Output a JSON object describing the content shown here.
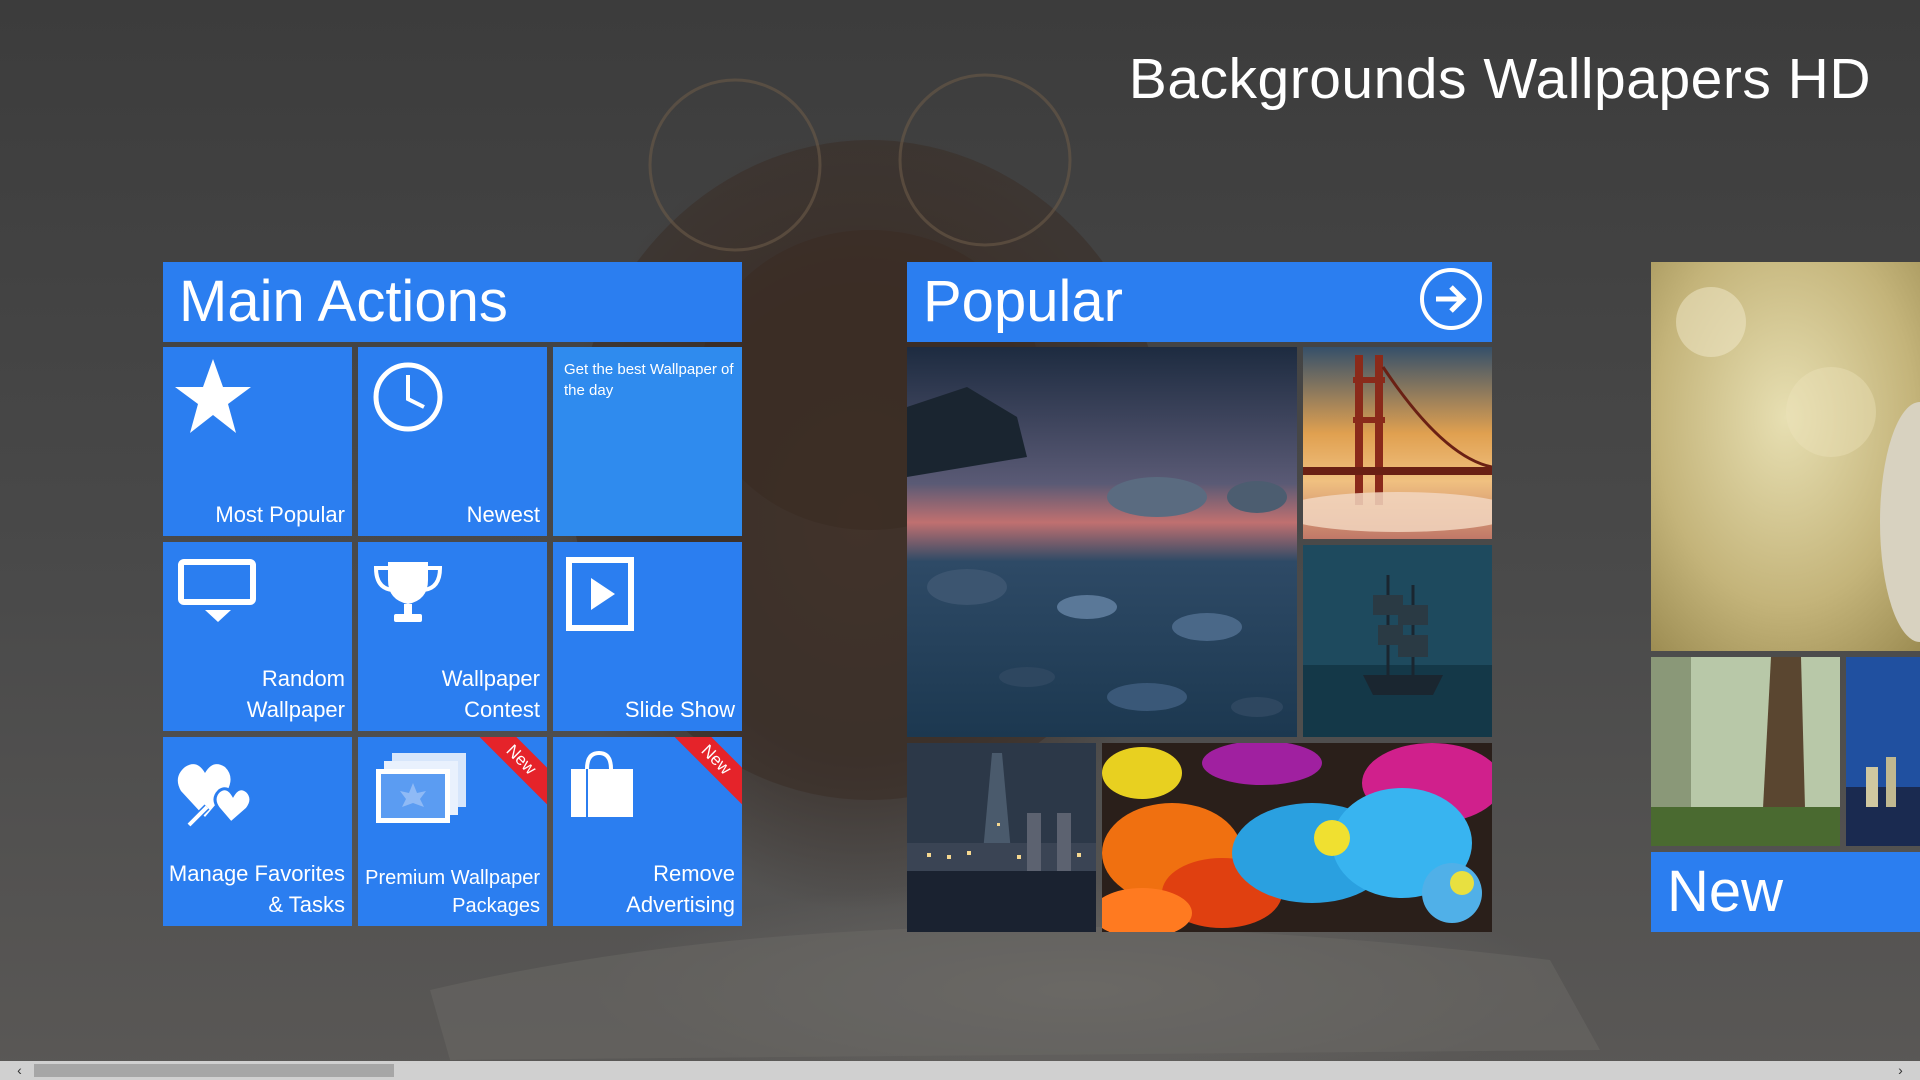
{
  "app": {
    "title": "Backgrounds Wallpapers HD"
  },
  "main_actions": {
    "header": "Main Actions",
    "tiles": [
      {
        "label": "Most Popular",
        "icon": "star-icon"
      },
      {
        "label": "Newest",
        "icon": "clock-icon"
      },
      {
        "tagline": "Get the best Wallpaper of the day"
      },
      {
        "line1": "Random",
        "line2": "Wallpaper",
        "icon": "monitor-icon"
      },
      {
        "line1": "Wallpaper",
        "line2": "Contest",
        "icon": "trophy-icon"
      },
      {
        "label": "Slide Show",
        "icon": "play-icon"
      },
      {
        "line1": "Manage Favorites",
        "line2": "& Tasks",
        "icon": "heart-wrench-icon"
      },
      {
        "line1": "Premium Wallpaper",
        "line2": "Packages",
        "icon": "wallpaper-stack-icon",
        "badge": "New"
      },
      {
        "line1": "Remove",
        "line2": "Advertising",
        "icon": "shopping-bag-icon",
        "badge": "New"
      }
    ]
  },
  "popular": {
    "header": "Popular",
    "arrow_icon": "arrow-right-circle-icon",
    "photos": [
      "lake-rocks",
      "golden-gate-bridge",
      "sailing-ship",
      "london-skyline",
      "colorful-daisies"
    ]
  },
  "new_section": {
    "header": "New"
  },
  "colors": {
    "tile_blue": "#2b7ef0",
    "ribbon_red": "#e5232a"
  }
}
